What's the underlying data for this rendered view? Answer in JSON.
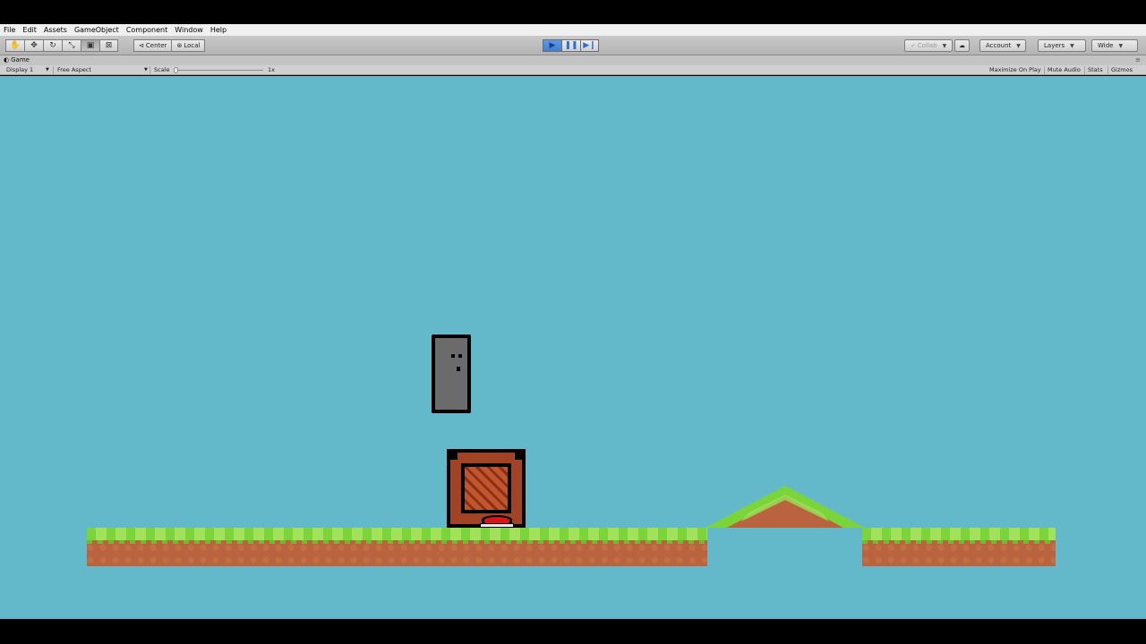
{
  "menu": [
    "File",
    "Edit",
    "Assets",
    "GameObject",
    "Component",
    "Window",
    "Help"
  ],
  "toolbar": {
    "tools": [
      "hand-icon",
      "move-icon",
      "rotate-icon",
      "scale-icon",
      "rect-icon",
      "transform-icon"
    ],
    "pivot_label": "Center",
    "space_label": "Local",
    "collab_label": "Collab",
    "account_label": "Account",
    "layers_label": "Layers",
    "layout_label": "Wide"
  },
  "game_panel": {
    "tab_label": "Game",
    "display_label": "Display 1",
    "aspect_label": "Free Aspect",
    "scale_label": "Scale",
    "scale_value": "1x",
    "options": [
      "Maximize On Play",
      "Mute Audio",
      "Stats",
      "Gizmos"
    ]
  },
  "colors": {
    "sky": "#63b9c9",
    "grass": "#7bd53a",
    "dirt": "#b9643e",
    "crate": "#a14325",
    "player": "#6b6b6b"
  }
}
